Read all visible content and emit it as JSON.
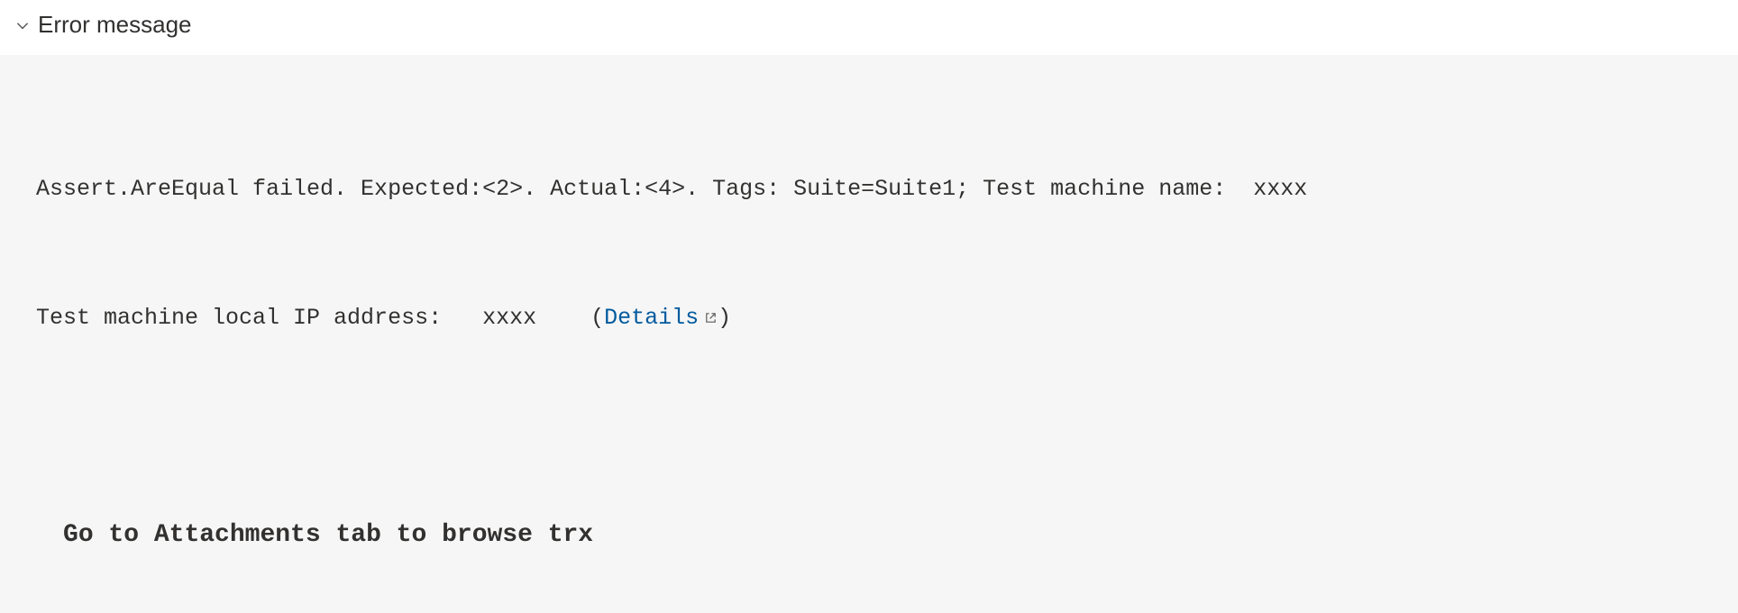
{
  "section": {
    "title": "Error message"
  },
  "error": {
    "line1_prefix": "Assert.AreEqual failed. Expected:<2>. Actual:<4>. Tags: Suite=Suite1; Test machine name:  ",
    "line1_redacted": "xxxx",
    "line2_prefix": "Test machine local IP address:   ",
    "line2_redacted": "xxxx",
    "details_label": "Details",
    "hint": "Go to Attachments tab to browse trx"
  }
}
